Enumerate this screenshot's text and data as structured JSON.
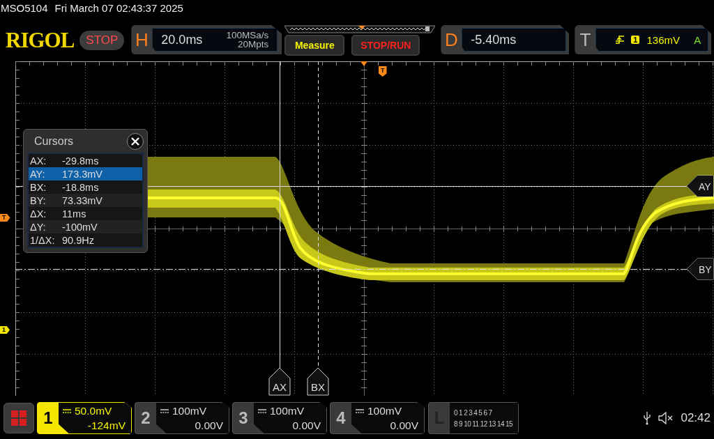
{
  "status_line": {
    "model": "MSO5104",
    "datetime": "Fri March 07 02:43:37 2025"
  },
  "logo": "RIGOL",
  "run_state": "STOP",
  "horizontal": {
    "label": "H",
    "timebase": "20.0ms",
    "sample_rate": "100MSa/s",
    "memory_depth": "20Mpts"
  },
  "buttons": [
    {
      "label": "Measure",
      "kind": "measure"
    },
    {
      "label": "STOP/RUN",
      "kind": "run-control"
    }
  ],
  "delay": {
    "label": "D",
    "value": "-5.40ms"
  },
  "trigger": {
    "label": "T",
    "source": "1",
    "voltage": "136mV",
    "mode": "A"
  },
  "plot_markers": {
    "trigger_position": "T",
    "trigger_level": "T",
    "channel": "1"
  },
  "cursor_panel": {
    "title": "Cursors",
    "rows": [
      {
        "label": "AX:",
        "value": "-29.8ms",
        "selected": false
      },
      {
        "label": "AY:",
        "value": "173.3mV",
        "selected": true
      },
      {
        "label": "BX:",
        "value": "-18.8ms",
        "selected": false
      },
      {
        "label": "BY:",
        "value": "73.33mV",
        "selected": false
      },
      {
        "label": "ΔX:",
        "value": "11ms",
        "selected": false
      },
      {
        "label": "ΔY:",
        "value": "-100mV",
        "selected": false
      },
      {
        "label": "1/ΔX:",
        "value": "90.9Hz",
        "selected": false
      }
    ]
  },
  "cursor_labels": [
    {
      "label": "AX",
      "kind": "vertical"
    },
    {
      "label": "BX",
      "kind": "vertical"
    },
    {
      "label": "AY",
      "kind": "horizontal"
    },
    {
      "label": "BY",
      "kind": "horizontal"
    }
  ],
  "channels": [
    {
      "number": "1",
      "scale": "50.0mV",
      "offset": "-124mV",
      "selected": true
    },
    {
      "number": "2",
      "scale": "100mV",
      "offset": "0.00V",
      "selected": false
    },
    {
      "number": "3",
      "scale": "100mV",
      "offset": "0.00V",
      "selected": false
    },
    {
      "number": "4",
      "scale": "100mV",
      "offset": "0.00V",
      "selected": false
    }
  ],
  "logic": {
    "label": "L",
    "row_1": [
      "0",
      "1",
      "2",
      "3",
      "4",
      "5",
      "6",
      "7"
    ],
    "row_2": [
      "8",
      "9",
      "10",
      "11",
      "12",
      "13",
      "14",
      "15"
    ]
  },
  "clock": "02:42"
}
